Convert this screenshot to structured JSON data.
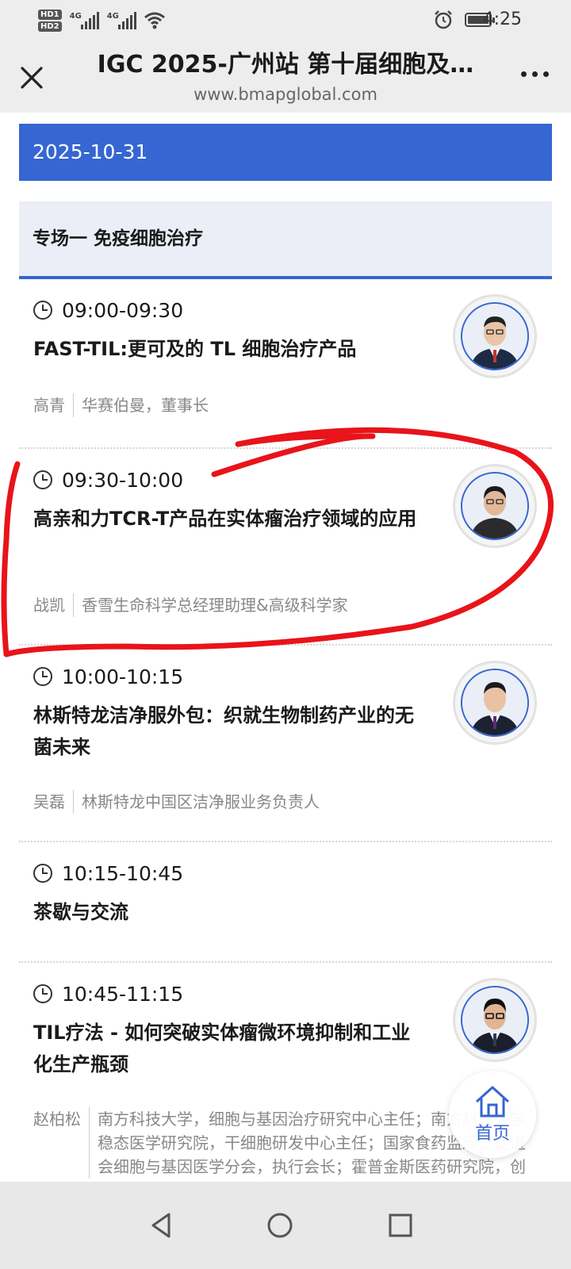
{
  "status_bar": {
    "hd1": "HD1",
    "hd2": "HD2",
    "signal_label_1": "4G",
    "signal_label_2": "4G",
    "time": "4:25",
    "icons": [
      "signal-icon",
      "wifi-icon",
      "alarm-icon",
      "battery-icon"
    ]
  },
  "header": {
    "title": "IGC 2025-广州站 第十届细胞及…",
    "url": "www.bmapglobal.com"
  },
  "date": "2025-10-31",
  "session": "专场一 免疫细胞治疗",
  "items": [
    {
      "time": "09:00-09:30",
      "title": "FAST-TIL:更可及的 TL 细胞治疗产品",
      "speaker": "高青",
      "org": "华赛伯曼，董事长"
    },
    {
      "time": "09:30-10:00",
      "title": "高亲和力TCR-T产品在实体瘤治疗领域的应用",
      "speaker": "战凯",
      "org": "香雪生命科学总经理助理&高级科学家"
    },
    {
      "time": "10:00-10:15",
      "title": "林斯特龙洁净服外包：织就生物制药产业的无菌未来",
      "speaker": "吴磊",
      "org": "林斯特龙中国区洁净服业务负责人"
    },
    {
      "time": "10:15-10:45",
      "title": "茶歇与交流"
    },
    {
      "time": "10:45-11:15",
      "title": "TIL疗法 - 如何突破实体瘤微环境抑制和工业化生产瓶颈",
      "speaker": "赵柏松",
      "org": "南方科技大学，细胞与基因治疗研究中心主任；南方科技大学稳态医学研究院，干细胞研发中心主任；国家食药监局…促进会细胞与基因医学分会，执行会长；霍普金斯医药研究院，创"
    }
  ],
  "home_button": "首页",
  "colors": {
    "accent": "#3566d2",
    "session_bg": "#ebeef6",
    "annotation": "#e8141a"
  }
}
